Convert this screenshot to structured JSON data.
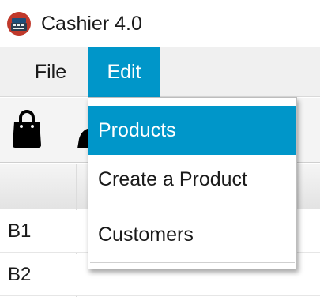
{
  "window": {
    "title": "Cashier 4.0",
    "icon": "cash-register-icon"
  },
  "menubar": {
    "items": [
      {
        "label": "File",
        "state": "normal"
      },
      {
        "label": "Edit",
        "state": "open"
      }
    ]
  },
  "edit_menu": {
    "items": [
      {
        "label": "Products",
        "state": "highlighted"
      },
      {
        "label": "Create a Product",
        "state": "normal"
      },
      {
        "label": "Customers",
        "state": "normal"
      }
    ]
  },
  "toolbar": {
    "icons": [
      "shopping-bag-icon",
      "partial-tool-icon"
    ]
  },
  "table": {
    "rows": [
      {
        "id": "B1"
      },
      {
        "id": "B2"
      }
    ]
  },
  "colors": {
    "accent": "#0096c9",
    "menubar_bg": "#f0f0f0",
    "text": "#1a1a1a",
    "icon_red": "#c0392b"
  }
}
